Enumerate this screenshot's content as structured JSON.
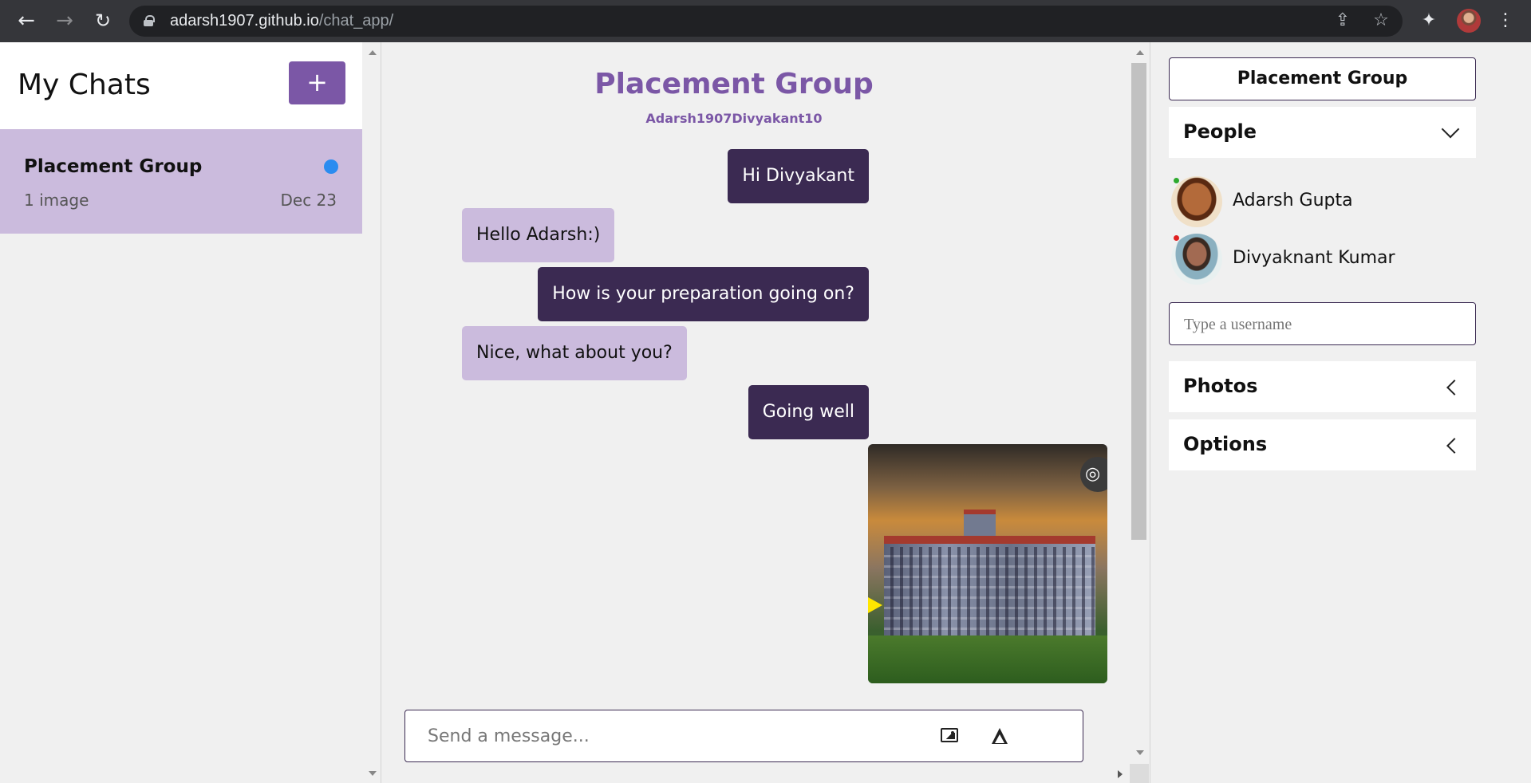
{
  "browser": {
    "url_host": "adarsh1907.github.io",
    "url_path": "/chat_app/"
  },
  "left": {
    "title": "My Chats",
    "add_label": "+",
    "chats": [
      {
        "name": "Placement Group",
        "last_message": "1 image",
        "date": "Dec 23",
        "unread_color": "#2b8cf0"
      }
    ]
  },
  "chat": {
    "title": "Placement Group",
    "subtitle": "Adarsh1907Divyakant10",
    "messages": [
      {
        "text": "Hi Divyakant",
        "direction": "out"
      },
      {
        "text": "Hello Adarsh:)",
        "direction": "in"
      },
      {
        "text": "How is your preparation going on?",
        "direction": "out"
      },
      {
        "text": "Nice, what about you?",
        "direction": "in"
      },
      {
        "text": "Going well",
        "direction": "out"
      }
    ],
    "composer_placeholder": "Send a message..."
  },
  "right": {
    "group_name": "Placement Group",
    "people_label": "People",
    "people": [
      {
        "name": "Adarsh Gupta",
        "status_color": "#2eaa2e"
      },
      {
        "name": "Divyaknant Kumar",
        "status_color": "#e02020"
      }
    ],
    "username_placeholder": "Type a username",
    "photos_label": "Photos",
    "options_label": "Options"
  },
  "colors": {
    "accent": "#7b57a6",
    "bubble_out": "#3b2a52",
    "bubble_in": "#cbbbdd"
  }
}
